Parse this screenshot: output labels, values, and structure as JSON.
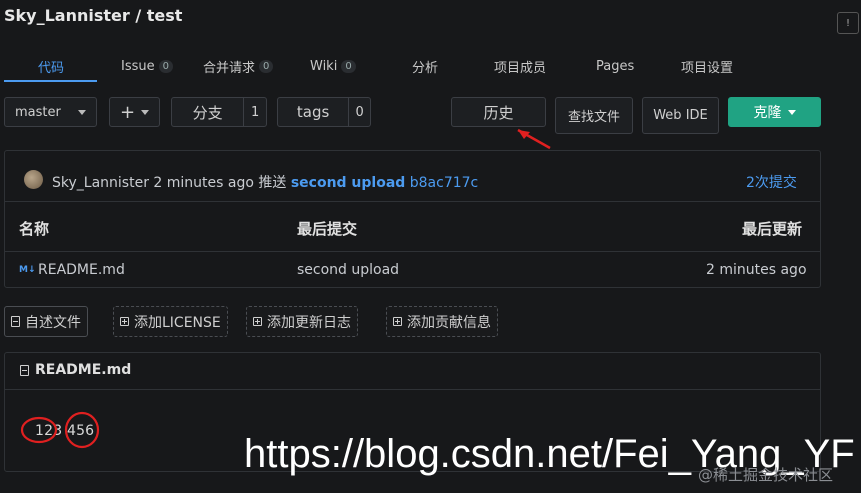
{
  "repo": {
    "title": "Sky_Lannister / test"
  },
  "tabs": [
    {
      "label": "代码"
    },
    {
      "label": "Issue",
      "count": "0"
    },
    {
      "label": "合并请求",
      "count": "0"
    },
    {
      "label": "Wiki",
      "count": "0"
    },
    {
      "label": "分析"
    },
    {
      "label": "项目成员"
    },
    {
      "label": "Pages"
    },
    {
      "label": "项目设置"
    }
  ],
  "toolbar": {
    "branch": "master",
    "add_label": "+",
    "branches_label": "分支",
    "branches_count": "1",
    "tags_label": "tags",
    "tags_count": "0",
    "history_label": "历史",
    "find_file_label": "查找文件",
    "web_ide_label": "Web IDE",
    "clone_label": "克隆",
    "accent": "#20a383"
  },
  "last_commit": {
    "author": "Sky_Lannister",
    "time": "2 minutes ago",
    "action": "推送",
    "message": "second upload",
    "sha": "b8ac717c",
    "commits_link": "2次提交"
  },
  "file_table": {
    "headers": [
      "名称",
      "最后提交",
      "最后更新"
    ],
    "rows": [
      {
        "name": "README.md",
        "commit": "second upload",
        "updated": "2 minutes ago",
        "icon": "markdown-icon"
      }
    ]
  },
  "actions": {
    "readme": "自述文件",
    "license": "添加LICENSE",
    "changelog": "添加更新日志",
    "contributing": "添加贡献信息"
  },
  "readme": {
    "title": "README.md",
    "content": "123 456"
  },
  "watermark": {
    "url": "https://blog.csdn.net/Fei_Yang_YF",
    "juejin": "@稀土掘金技术社区"
  }
}
